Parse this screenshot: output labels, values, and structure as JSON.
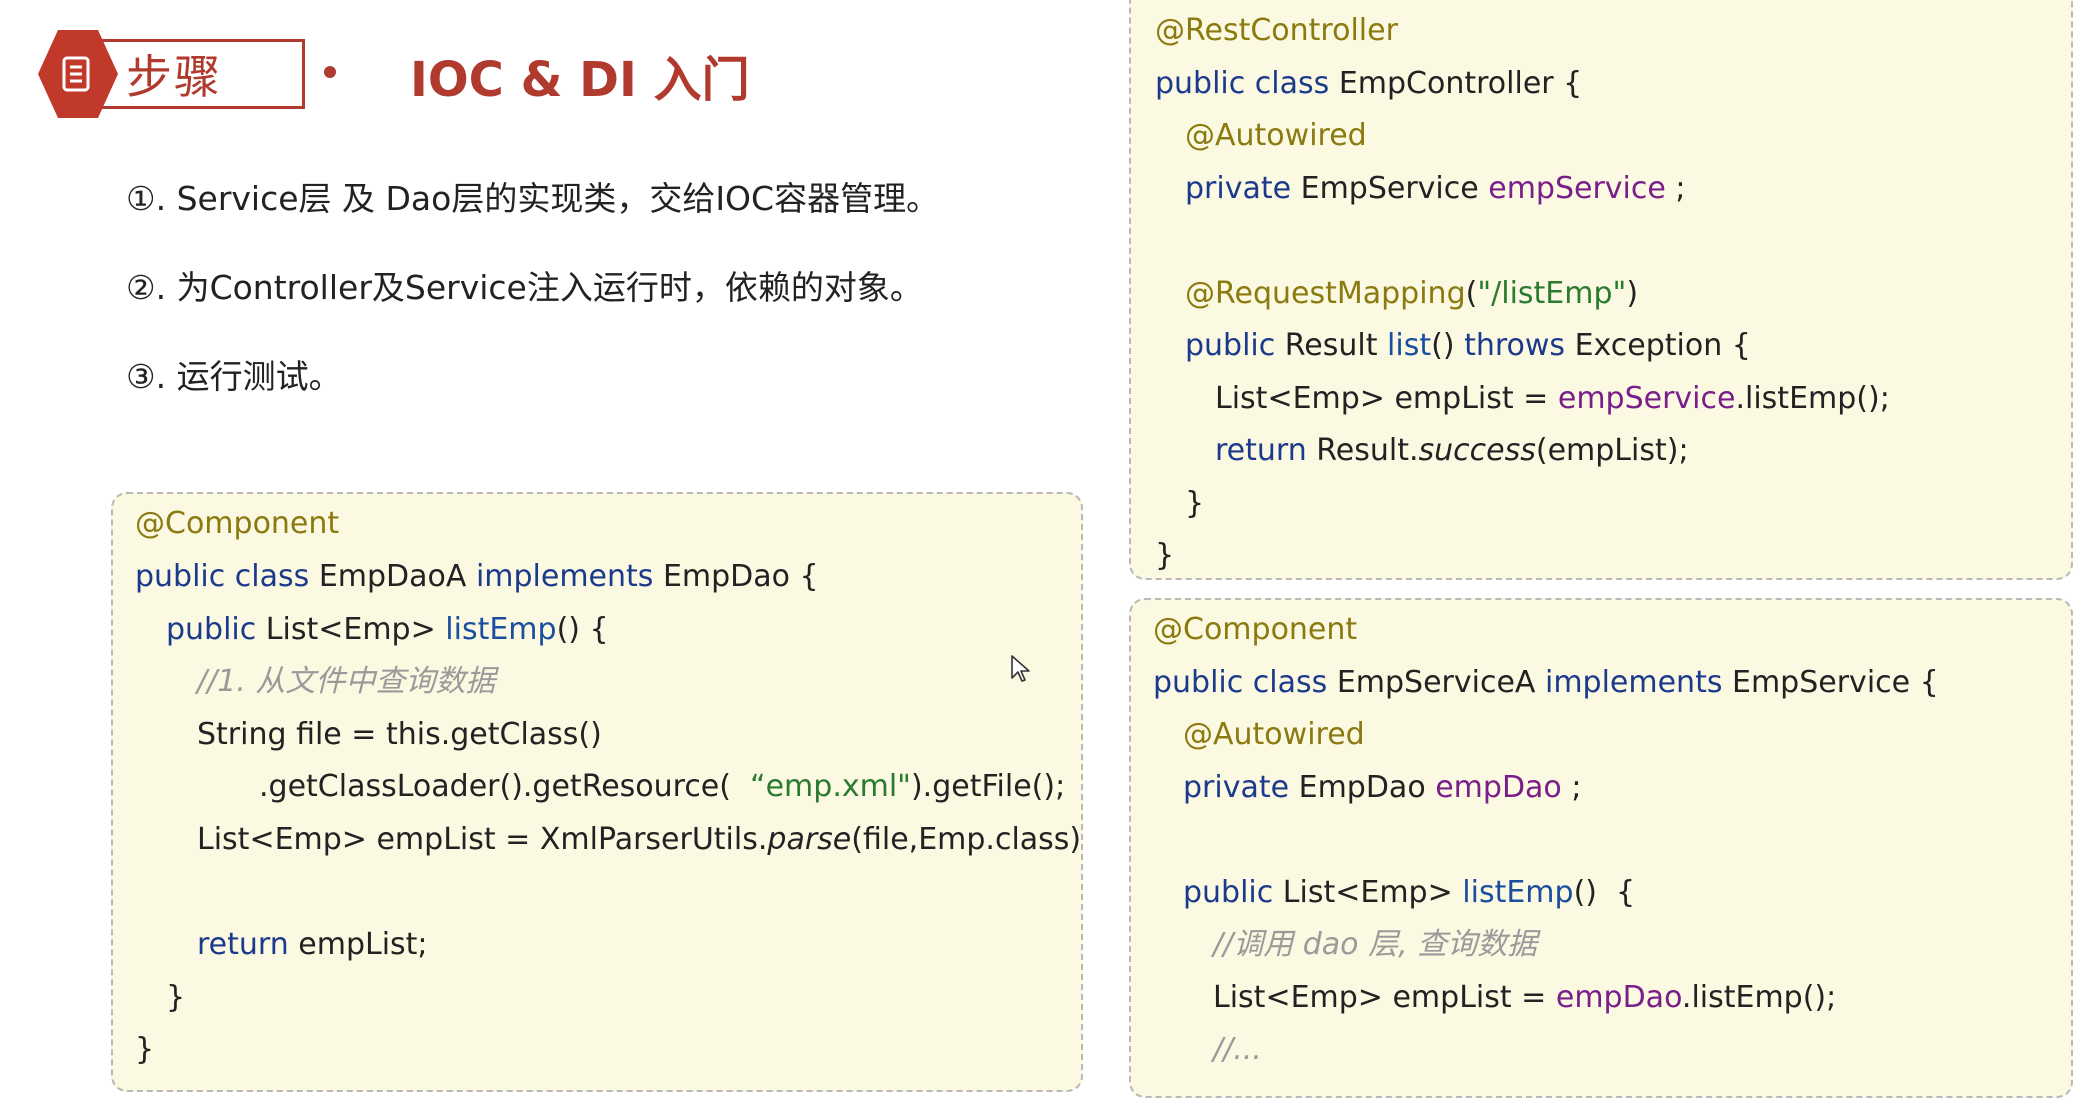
{
  "header": {
    "badge_label": "步骤",
    "title": "IOC & DI 入门"
  },
  "steps": [
    "①. Service层 及 Dao层的实现类，交给IOC容器管理。",
    "②. 为Controller及Service注入运行时，依赖的对象。",
    "③. 运行测试。"
  ],
  "code": {
    "dao": {
      "l1": "@Component",
      "l2_a": "public class",
      "l2_b": " EmpDaoA ",
      "l2_c": "implements",
      "l2_d": " EmpDao {",
      "l3_a": "public",
      "l3_b": " List<Emp> ",
      "l3_c": "listEmp",
      "l3_d": "() {",
      "l4": "//1. 从文件中查询数据",
      "l5": "String file = this.getClass()",
      "l6_a": ".getClassLoader().getResource(  ",
      "l6_b": "“emp.xml\"",
      "l6_c": ").getFile();",
      "l7_a": "List<Emp> empList = XmlParserUtils.",
      "l7_b": "parse",
      "l7_c": "(file,Emp.class);",
      "l8_a": "return",
      "l8_b": " empList;",
      "l9": "}",
      "l10": "}"
    },
    "controller": {
      "l1": "@RestController",
      "l2_a": "public class",
      "l2_b": " EmpController {",
      "l3": "@Autowired",
      "l4_a": "private",
      "l4_b": " EmpService ",
      "l4_c": "empService",
      "l4_d": " ;",
      "l5_a": "@RequestMapping",
      "l5_b": "(",
      "l5_c": "\"/listEmp\"",
      "l5_d": ")",
      "l6_a": "public",
      "l6_b": " Result ",
      "l6_c": "list",
      "l6_d": "() ",
      "l6_e": "throws",
      "l6_f": " Exception {",
      "l7_a": "List<Emp> empList = ",
      "l7_b": "empService",
      "l7_c": ".listEmp();",
      "l8_a": "return",
      "l8_b": " Result.",
      "l8_c": "success",
      "l8_d": "(empList);",
      "l9": "}",
      "l10": "}"
    },
    "service": {
      "l1": "@Component",
      "l2_a": "public class",
      "l2_b": " EmpServiceA ",
      "l2_c": "implements",
      "l2_d": " EmpService {",
      "l3": "@Autowired",
      "l4_a": "private",
      "l4_b": " EmpDao ",
      "l4_c": "empDao",
      "l4_d": " ;",
      "l5_a": "public",
      "l5_b": " List<Emp> ",
      "l5_c": "listEmp",
      "l5_d": "()  {",
      "l6": "//调用 dao 层, 查询数据",
      "l7_a": "List<Emp> empList = ",
      "l7_b": "empDao",
      "l7_c": ".listEmp();",
      "l8": "//..."
    }
  },
  "colors": {
    "accent": "#b03a2e",
    "code_bg": "#fbf9e2",
    "keyword": "#1c3a8c",
    "annotation": "#8a7a10",
    "field": "#7a1e8a",
    "string": "#2a7a30"
  },
  "icons": {
    "badge_icon": "document-icon",
    "cursor_icon": "mouse-pointer-icon"
  }
}
